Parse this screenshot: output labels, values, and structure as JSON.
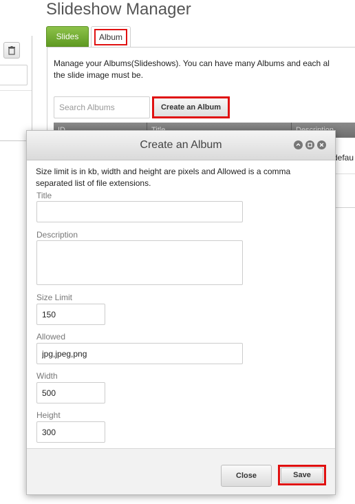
{
  "page": {
    "title": "Slideshow Manager"
  },
  "tabs": [
    {
      "label": "Slides",
      "active": false
    },
    {
      "label": "Album",
      "active": true
    }
  ],
  "album_tab": {
    "intro_line1": "Manage your Albums(Slideshows). You can have many Albums and each al",
    "intro_line2": "the slide image must be.",
    "search_placeholder": "Search Albums",
    "create_button": "Create an Album",
    "table": {
      "columns": [
        "ID",
        "Title",
        "Description"
      ],
      "visible_cell": "defau"
    }
  },
  "dialog": {
    "title": "Create an Album",
    "description": "Size limit is in kb, width and height are pixels and Allowed is a comma separated list of file extensions.",
    "fields": {
      "title_label": "Title",
      "title_value": "",
      "description_label": "Description",
      "description_value": "",
      "size_limit_label": "Size Limit",
      "size_limit_value": "150",
      "allowed_label": "Allowed",
      "allowed_value": "jpg,jpeg,png",
      "width_label": "Width",
      "width_value": "500",
      "height_label": "Height",
      "height_value": "300"
    },
    "buttons": {
      "close": "Close",
      "save": "Save"
    }
  },
  "colors": {
    "highlight": "#e01010",
    "tab_green": "#6aa82b",
    "header_gray": "#7a7a7a"
  }
}
